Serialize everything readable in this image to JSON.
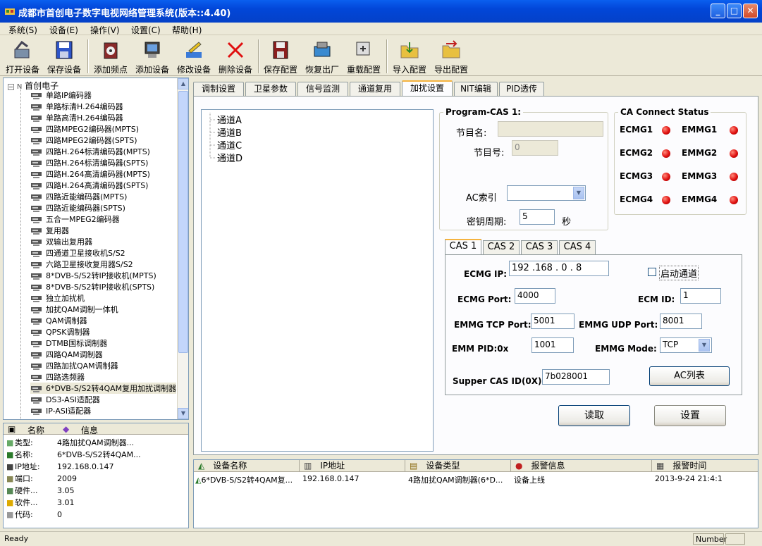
{
  "window": {
    "title": "成都市首创电子数字电视网络管理系统(版本::4.40)"
  },
  "menu": [
    "系统(S)",
    "设备(E)",
    "操作(V)",
    "设置(C)",
    "帮助(H)"
  ],
  "toolbar": [
    "打开设备",
    "保存设备",
    "添加频点",
    "添加设备",
    "修改设备",
    "删除设备",
    "保存配置",
    "恢复出厂",
    "重载配置",
    "导入配置",
    "导出配置"
  ],
  "tree": {
    "root": "首创电子",
    "items": [
      "单路IP编码器",
      "单路标清H.264编码器",
      "单路高清H.264编码器",
      "四路MPEG2编码器(MPTS)",
      "四路MPEG2编码器(SPTS)",
      "四路H.264标清编码器(MPTS)",
      "四路H.264标清编码器(SPTS)",
      "四路H.264高清编码器(MPTS)",
      "四路H.264高清编码器(SPTS)",
      "四路近能编码器(MPTS)",
      "四路近能编码器(SPTS)",
      "五合一MPEG2编码器",
      "复用器",
      "双输出复用器",
      "四通道卫星接收机S/S2",
      "六路卫星接收复用器S/S2",
      "8*DVB-S/S2转IP接收机(MPTS)",
      "8*DVB-S/S2转IP接收机(SPTS)",
      "独立加扰机",
      "加扰QAM调制一体机",
      "QAM调制器",
      "QPSK调制器",
      "DTMB国标调制器",
      "四路QAM调制器",
      "四路加扰QAM调制器",
      "四路选频器",
      "6*DVB-S/S2转4QAM复用加扰调制器",
      "DS3-ASI适配器",
      "IP-ASI适配器"
    ]
  },
  "info": {
    "headers": [
      "名称",
      "信息"
    ],
    "rows": [
      {
        "k": "类型:",
        "v": "4路加扰QAM调制器..."
      },
      {
        "k": "名称:",
        "v": "6*DVB-S/S2转4QAM..."
      },
      {
        "k": "IP地址:",
        "v": "192.168.0.147"
      },
      {
        "k": "端口:",
        "v": "2009"
      },
      {
        "k": "硬件...",
        "v": "3.05"
      },
      {
        "k": "软件...",
        "v": "3.01"
      },
      {
        "k": "代码:",
        "v": "0"
      }
    ]
  },
  "tabs": [
    "调制设置",
    "卫星参数",
    "信号监测",
    "通道复用",
    "加扰设置",
    "NIT编辑",
    "PID透传"
  ],
  "channels": [
    "通道A",
    "通道B",
    "通道C",
    "通道D"
  ],
  "program_cas": {
    "title": "Program-CAS 1:",
    "program_name_label": "节目名:",
    "program_name": "",
    "program_no_label": "节目号:",
    "program_no": "0",
    "ac_index_label": "AC索引",
    "ac_index": "",
    "key_period_label": "密钥周期:",
    "key_period": "5",
    "key_period_unit": "秒"
  },
  "ca_status": {
    "title": "CA Connect Status",
    "items": [
      "ECMG1",
      "EMMG1",
      "ECMG2",
      "EMMG2",
      "ECMG3",
      "EMMG3",
      "ECMG4",
      "EMMG4"
    ],
    "led_color": "#E01010"
  },
  "cas_tabs": [
    "CAS 1",
    "CAS 2",
    "CAS 3",
    "CAS 4"
  ],
  "cas": {
    "ecmg_ip_label": "ECMG IP:",
    "ecmg_ip": "192 .168 .  0  .  8",
    "enable_label": "启动通道",
    "ecmg_port_label": "ECMG Port:",
    "ecmg_port": "4000",
    "ecm_id_label": "ECM ID:",
    "ecm_id": "1",
    "emmg_tcp_label": "EMMG TCP Port:",
    "emmg_tcp": "5001",
    "emmg_udp_label": "EMMG UDP Port:",
    "emmg_udp": "8001",
    "emm_pid_label": "EMM PID:0x",
    "emm_pid": "1001",
    "emmg_mode_label": "EMMG Mode:",
    "emmg_mode": "TCP",
    "super_cas_label": "Supper CAS ID(0X):",
    "super_cas": "7b028001",
    "ac_list_button": "AC列表"
  },
  "actions": {
    "read": "读取",
    "set": "设置"
  },
  "list": {
    "headers": [
      "设备名称",
      "IP地址",
      "设备类型",
      "报警信息",
      "报警时间"
    ],
    "rows": [
      [
        "6*DVB-S/S2转4QAM复...",
        "192.168.0.147",
        "4路加扰QAM调制器(6*D...",
        "设备上线",
        "2013-9-24 21:4:1"
      ]
    ]
  },
  "status": {
    "left": "Ready",
    "right": "Number"
  }
}
